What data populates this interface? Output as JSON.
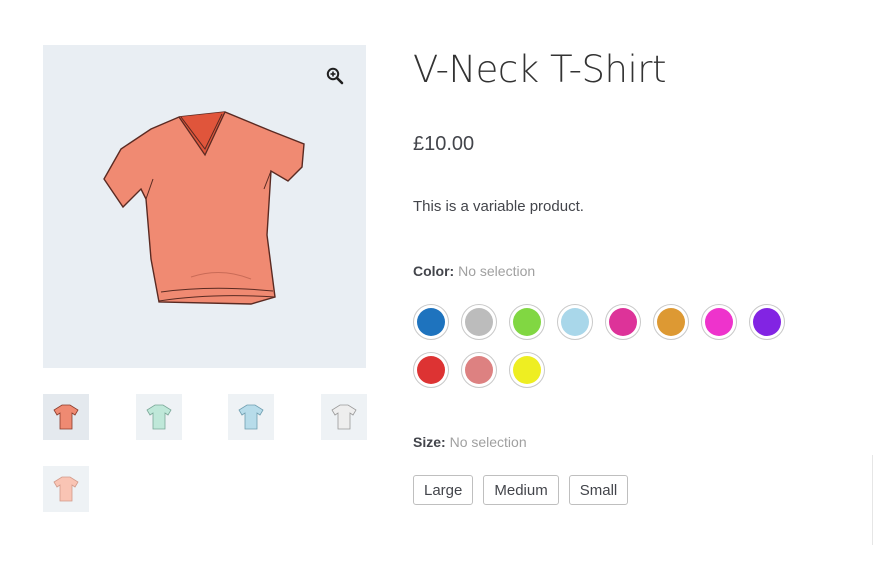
{
  "product": {
    "title": "V-Neck T-Shirt",
    "price": "£10.00",
    "description": "This is a variable product."
  },
  "gallery": {
    "zoom_icon": "magnifier-plus-icon",
    "main_image_color": "#f08a72",
    "thumbnails": [
      {
        "name": "thumbnail-red",
        "color": "#ef8a72"
      },
      {
        "name": "thumbnail-mint",
        "color": "#bfe8d9"
      },
      {
        "name": "thumbnail-light-blue",
        "color": "#b7dcea"
      },
      {
        "name": "thumbnail-white",
        "color": "#eeeeee"
      },
      {
        "name": "thumbnail-peach",
        "color": "#f9c4b4"
      }
    ]
  },
  "color_attr": {
    "label": "Color:",
    "selection": "No selection",
    "swatches": [
      "#1e73be",
      "#bcbcbc",
      "#81d742",
      "#a9d7ea",
      "#dd3399",
      "#dd9933",
      "#ee33cc",
      "#8224e3",
      "#dd3333",
      "#dd8181",
      "#eeee22"
    ]
  },
  "size_attr": {
    "label": "Size:",
    "selection": "No selection",
    "options": [
      "Large",
      "Medium",
      "Small"
    ]
  }
}
